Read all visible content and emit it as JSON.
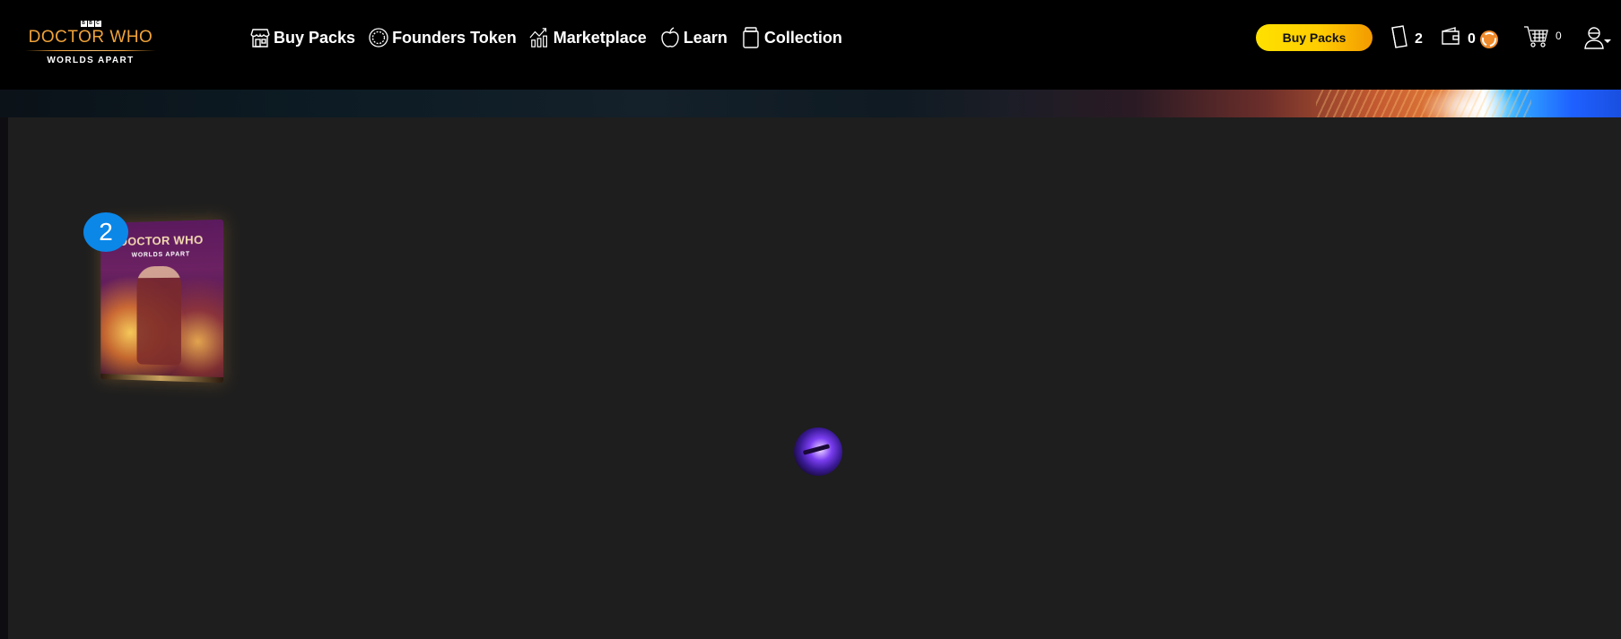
{
  "logo": {
    "bbc": [
      "B",
      "B",
      "C"
    ],
    "title": "DOCTOR WHO",
    "subtitle": "WORLDS APART"
  },
  "nav": [
    {
      "label": "Buy Packs",
      "icon": "store-icon"
    },
    {
      "label": "Founders Token",
      "icon": "token-icon"
    },
    {
      "label": "Marketplace",
      "icon": "marketplace-chart-icon"
    },
    {
      "label": "Learn",
      "icon": "apple-icon"
    },
    {
      "label": "Collection",
      "icon": "collection-jar-icon"
    }
  ],
  "header": {
    "buy_button_label": "Buy Packs",
    "packs_count": "2",
    "wallet_balance": "0",
    "cart_count": "0"
  },
  "content": {
    "pack": {
      "title": "DOCTOR WHO",
      "subtitle": "WORLDS APART",
      "quantity": "2"
    }
  },
  "colors": {
    "accent_gold": "#f0a23a",
    "buy_button_start": "#ffe100",
    "buy_button_end": "#f39a00",
    "badge_blue": "#0b87e8",
    "content_bg": "#1e1e1e",
    "header_bg": "#000000"
  }
}
